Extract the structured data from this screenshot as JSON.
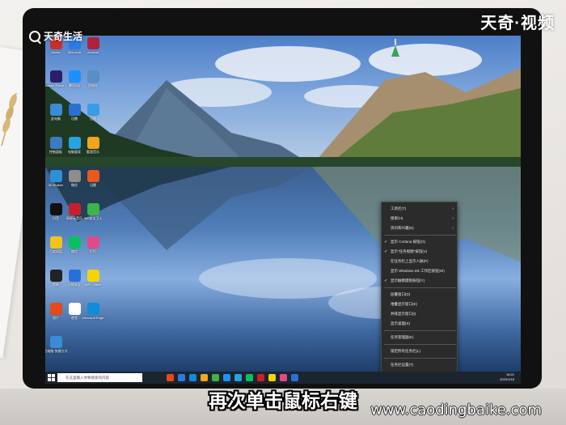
{
  "watermark": {
    "left_logo": "天奇生活",
    "right_brand": "天奇·视频"
  },
  "caption": "再次单击鼠标右键",
  "site_url": "www.caodingbaike.com",
  "desktop_icons": [
    {
      "label": "Adobe",
      "color": "#c9302c"
    },
    {
      "label": "Microsoft",
      "color": "#2d7be0"
    },
    {
      "label": "Acrobat",
      "color": "#b0213a"
    },
    {
      "label": "Adobe Premi...",
      "color": "#2a1f6b"
    },
    {
      "label": "腾讯QQ",
      "color": "#1e90ff"
    },
    {
      "label": "回收站",
      "color": "#5a8ec7"
    },
    {
      "label": "此电脑",
      "color": "#3a8bd8"
    },
    {
      "label": "迅雷",
      "color": "#2d6fd1"
    },
    {
      "label": "迅雷",
      "color": "#3a9be6"
    },
    {
      "label": "控制面板",
      "color": "#3b7bc2"
    },
    {
      "label": "电脑管家",
      "color": "#26a3e0"
    },
    {
      "label": "酷我音乐",
      "color": "#f2a51e"
    },
    {
      "label": "3D Builder",
      "color": "#2e90d9"
    },
    {
      "label": "微信",
      "color": "#8d8d8d"
    },
    {
      "label": "迅雷",
      "color": "#e85a1c"
    },
    {
      "label": "抖音",
      "color": "#111111"
    },
    {
      "label": "网易云音乐",
      "color": "#c8202a"
    },
    {
      "label": "360安全卫士",
      "color": "#3cb44a"
    },
    {
      "label": "百度网盘",
      "color": "#f0c419"
    },
    {
      "label": "微信",
      "color": "#07c160"
    },
    {
      "label": "钉钉",
      "color": "#e04a8a"
    },
    {
      "label": "剪映",
      "color": "#222222"
    },
    {
      "label": "火绒安全",
      "color": "#2a6fd6"
    },
    {
      "label": "WPS Office",
      "color": "#f5d30a"
    },
    {
      "label": "照片",
      "color": "#e64a19"
    },
    {
      "label": "便签",
      "color": "#ffffff"
    },
    {
      "label": "Microsoft Edge",
      "color": "#0f8dd6"
    },
    {
      "label": "此电脑 快捷方式",
      "color": "#3a8bd8"
    }
  ],
  "context_menu": {
    "items": [
      {
        "label": "工具栏(T)",
        "has_submenu": true,
        "checked": false
      },
      {
        "label": "搜索(H)",
        "has_submenu": true,
        "checked": false
      },
      {
        "label": "资讯和兴趣(N)",
        "has_submenu": true,
        "checked": false
      },
      {
        "label": "显示 Cortana 按钮(O)",
        "has_submenu": false,
        "checked": true
      },
      {
        "label": "显示\"任务视图\"按钮(V)",
        "has_submenu": false,
        "checked": true
      },
      {
        "label": "在任务栏上显示人脉(P)",
        "has_submenu": false,
        "checked": false
      },
      {
        "label": "显示 Windows Ink 工作区按钮(W)",
        "has_submenu": false,
        "checked": false
      },
      {
        "label": "显示触摸键盘按钮(Y)",
        "has_submenu": false,
        "checked": true
      },
      {
        "label": "层叠窗口(D)",
        "has_submenu": false,
        "checked": false
      },
      {
        "label": "堆叠显示窗口(E)",
        "has_submenu": false,
        "checked": false
      },
      {
        "label": "并排显示窗口(I)",
        "has_submenu": false,
        "checked": false
      },
      {
        "label": "显示桌面(S)",
        "has_submenu": false,
        "checked": false
      },
      {
        "label": "任务管理器(K)",
        "has_submenu": false,
        "checked": false
      },
      {
        "label": "锁定所有任务栏(L)",
        "has_submenu": false,
        "checked": false
      },
      {
        "label": "任务栏设置(T)",
        "has_submenu": false,
        "checked": false
      }
    ]
  },
  "taskbar": {
    "search_placeholder": "在这里输入你要搜索的内容",
    "apps": [
      "#e64a19",
      "#2d7be0",
      "#0f8dd6",
      "#f5a623",
      "#3cb44a",
      "#1e90ff",
      "#26a3e0",
      "#07c160",
      "#c8202a",
      "#f5d30a",
      "#e04a8a",
      "#2a6fd6"
    ],
    "time": "16:21",
    "date": "2022/1/18"
  }
}
